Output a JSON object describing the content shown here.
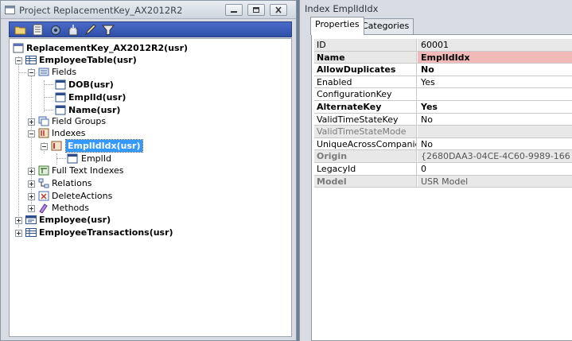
{
  "project_window": {
    "title": "Project ReplacementKey_AX2012R2",
    "toolbar_icons": [
      "open-folder-icon",
      "properties-icon",
      "compile-icon",
      "import-icon",
      "edit-icon",
      "filter-icon"
    ]
  },
  "tree": {
    "root": "ReplacementKey_AX2012R2(usr)",
    "employee_table": "EmployeeTable(usr)",
    "fields": "Fields",
    "field_dob": "DOB(usr)",
    "field_emplid": "EmplId(usr)",
    "field_name": "Name(usr)",
    "field_groups": "Field Groups",
    "indexes": "Indexes",
    "index_emplidx": "EmplIdIdx(usr)",
    "index_field_emplid": "EmplId",
    "full_text_indexes": "Full Text Indexes",
    "relations": "Relations",
    "delete_actions": "DeleteActions",
    "methods": "Methods",
    "employee": "Employee(usr)",
    "employee_transactions": "EmployeeTransactions(usr)"
  },
  "properties_window": {
    "title": "Index EmplIdIdx",
    "tabs": [
      "Properties",
      "Categories"
    ],
    "rows": [
      {
        "name": "ID",
        "value": "60001"
      },
      {
        "name": "Name",
        "value": "EmplIdIdx"
      },
      {
        "name": "AllowDuplicates",
        "value": "No"
      },
      {
        "name": "Enabled",
        "value": "Yes"
      },
      {
        "name": "ConfigurationKey",
        "value": ""
      },
      {
        "name": "AlternateKey",
        "value": "Yes"
      },
      {
        "name": "ValidTimeStateKey",
        "value": "No"
      },
      {
        "name": "ValidTimeStateMode",
        "value": ""
      },
      {
        "name": "UniqueAcrossCompanies",
        "value": "No"
      },
      {
        "name": "Origin",
        "value": "{2680DAA3-04CE-4C60-9989-166"
      },
      {
        "name": "LegacyId",
        "value": "0"
      },
      {
        "name": "Model",
        "value": "USR Model"
      }
    ]
  }
}
